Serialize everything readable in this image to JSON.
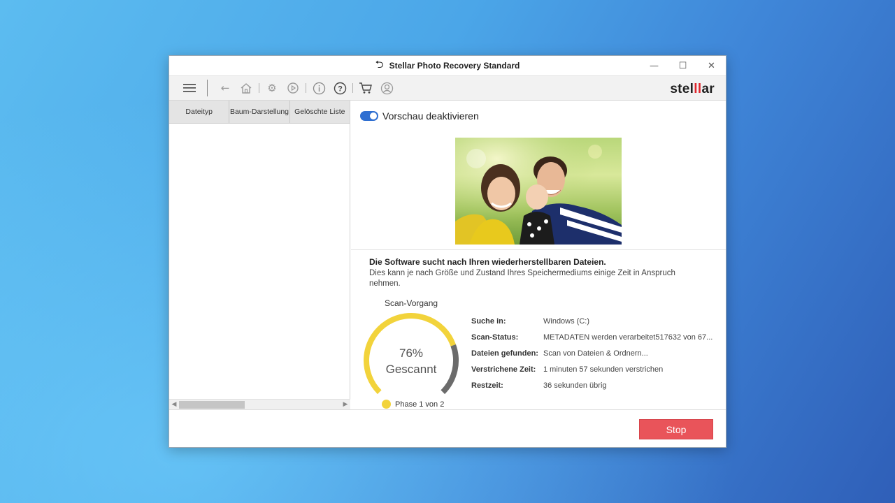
{
  "window": {
    "title": "Stellar Photo Recovery Standard",
    "controls": {
      "minimize": "—",
      "maximize": "☐",
      "close": "✕"
    }
  },
  "toolbar": {
    "logo_text_a": "stel",
    "logo_text_bars": "ll",
    "logo_text_b": "ar"
  },
  "left_panel": {
    "tabs": [
      "Dateityp",
      "Baum-Darstellung",
      "Gelöschte Liste"
    ],
    "scroll_thumb_fraction": 0.4
  },
  "preview": {
    "toggle_on": true,
    "toggle_label": "Vorschau deaktivieren"
  },
  "message": {
    "bold": "Die Software sucht nach Ihren wiederherstellbaren Dateien.",
    "text": "Dies kann je nach Größe und Zustand Ihres Speichermediums einige Zeit in Anspruch nehmen."
  },
  "scan": {
    "title": "Scan-Vorgang",
    "percent": 76,
    "percent_label": "76%",
    "scanned_label": "Gescannt",
    "phase": "Phase 1 von 2",
    "arc_color": "#f2d33b",
    "remaining_color": "#6b6b6b"
  },
  "info": [
    {
      "key": "Suche in:",
      "value": "Windows (C:)"
    },
    {
      "key": "Scan-Status:",
      "value": "METADATEN werden verarbeitet517632 von 67..."
    },
    {
      "key": "Dateien gefunden:",
      "value": "Scan von Dateien & Ordnern..."
    },
    {
      "key": "Verstrichene Zeit:",
      "value": "1 minuten 57 sekunden verstrichen"
    },
    {
      "key": "Restzeit:",
      "value": "36 sekunden übrig"
    }
  ],
  "footer": {
    "stop_label": "Stop",
    "stop_color": "#e9545a"
  }
}
